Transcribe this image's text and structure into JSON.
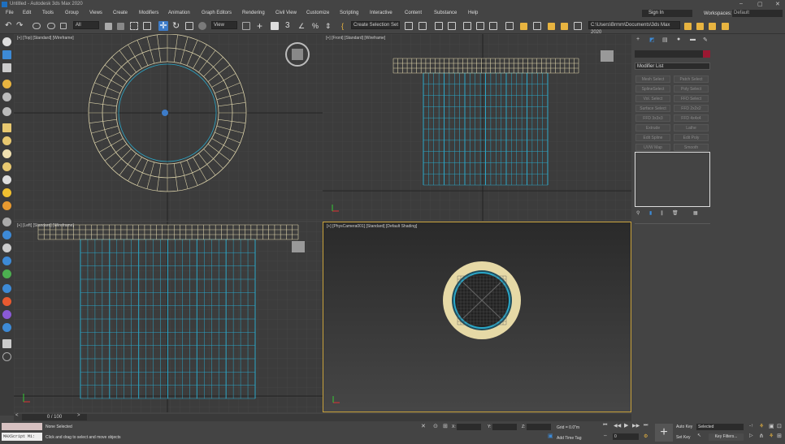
{
  "window": {
    "title": "Untitled - Autodesk 3ds Max 2020"
  },
  "menu": [
    "File",
    "Edit",
    "Tools",
    "Group",
    "Views",
    "Create",
    "Modifiers",
    "Animation",
    "Graph Editors",
    "Rendering",
    "Civil View",
    "Customize",
    "Scripting",
    "Interactive",
    "Content",
    "Substance",
    "Help"
  ],
  "account": {
    "signin": "Sign In",
    "workspaces_label": "Workspaces:",
    "workspace": "Default"
  },
  "toolbar": {
    "filter": "All",
    "refcoord": "View",
    "selection_set": "Create Selection Set",
    "path": "C:\\Users\\Brmm\\Documents\\3ds Max 2020"
  },
  "viewports": {
    "top": "[+] [Top] [Standard] [Wireframe]",
    "front": "[+] [Front] [Standard] [Wireframe]",
    "left": "[+] [Left] [Standard] [Wireframe]",
    "camera": "[+] [PhysCamera001] [Standard] [Default Shading]"
  },
  "command_panel": {
    "modifier_list": "Modifier List",
    "buttons": [
      "Mesh Select",
      "Patch Select",
      "SplineSelect",
      "Poly Select",
      "Vol. Select",
      "FFD Select",
      "Surface Select",
      "FFD 2x2x2",
      "FFD 3x3x3",
      "FFD 4x4x4",
      "Extrude",
      "Lathe",
      "Edit Spline",
      "Edit Poly",
      "UVW Map",
      "Smooth"
    ]
  },
  "timeline": {
    "frame": "0 / 100"
  },
  "status": {
    "maxscript": "MAXScript Mi:",
    "selection": "None Selected",
    "hint": "Click and drag to select and move objects",
    "x_label": "X:",
    "y_label": "Y:",
    "z_label": "Z:",
    "grid": "Grid = 0.0\"m",
    "add_time_tag": "Add Time Tag",
    "auto_key": "Auto Key",
    "selected": "Selected",
    "set_key": "Set Key",
    "key_filters": "Key Filters...",
    "current_frame": "0"
  },
  "colors": {
    "accent": "#1e6fbf",
    "wire": "#d9d0a8",
    "blue_wire": "#2aa7c8",
    "camera_border": "#c9a23b"
  }
}
